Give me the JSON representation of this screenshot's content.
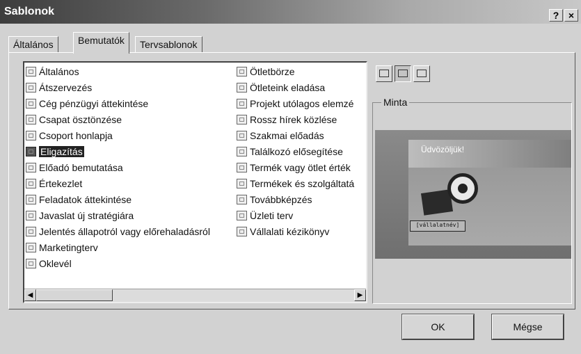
{
  "window": {
    "title": "Sablonok",
    "help_label": "?",
    "close_label": "×"
  },
  "tabs": [
    {
      "label": "Általános",
      "active": false
    },
    {
      "label": "Bemutatók",
      "active": true
    },
    {
      "label": "Tervsablonok",
      "active": false
    }
  ],
  "templates": {
    "column1": [
      "Általános",
      "Átszervezés",
      "Cég pénzügyi áttekintése",
      "Csapat ösztönzése",
      "Csoport honlapja",
      "Eligazítás",
      "Előadó bemutatása",
      "Értekezlet",
      "Feladatok áttekintése",
      "Javaslat új stratégiára",
      "Jelentés állapotról vagy előrehaladásról",
      "Marketingterv",
      "Oklevél"
    ],
    "column2": [
      "Ötletbörze",
      "Ötleteink eladása",
      "Projekt utólagos elemzé",
      "Rossz hírek közlése",
      "Szakmai előadás",
      "Találkozó elősegítése",
      "Termék vagy ötlet érték",
      "Termékek és szolgáltatá",
      "Továbbképzés",
      "Üzleti terv",
      "Vállalati kézikönyv"
    ],
    "selected": "Eligazítás"
  },
  "preview": {
    "group_label": "Minta",
    "welcome_text": "Üdvözöljük!",
    "name_text": "[vállalatnév]"
  },
  "buttons": {
    "ok": "OK",
    "cancel": "Mégse"
  },
  "icons": {
    "list_item": "template-file-icon",
    "view_large": "large-icons-view-icon",
    "view_list": "list-view-icon",
    "view_details": "details-view-icon",
    "scroll_left": "scroll-left-arrow-icon",
    "scroll_right": "scroll-right-arrow-icon"
  }
}
